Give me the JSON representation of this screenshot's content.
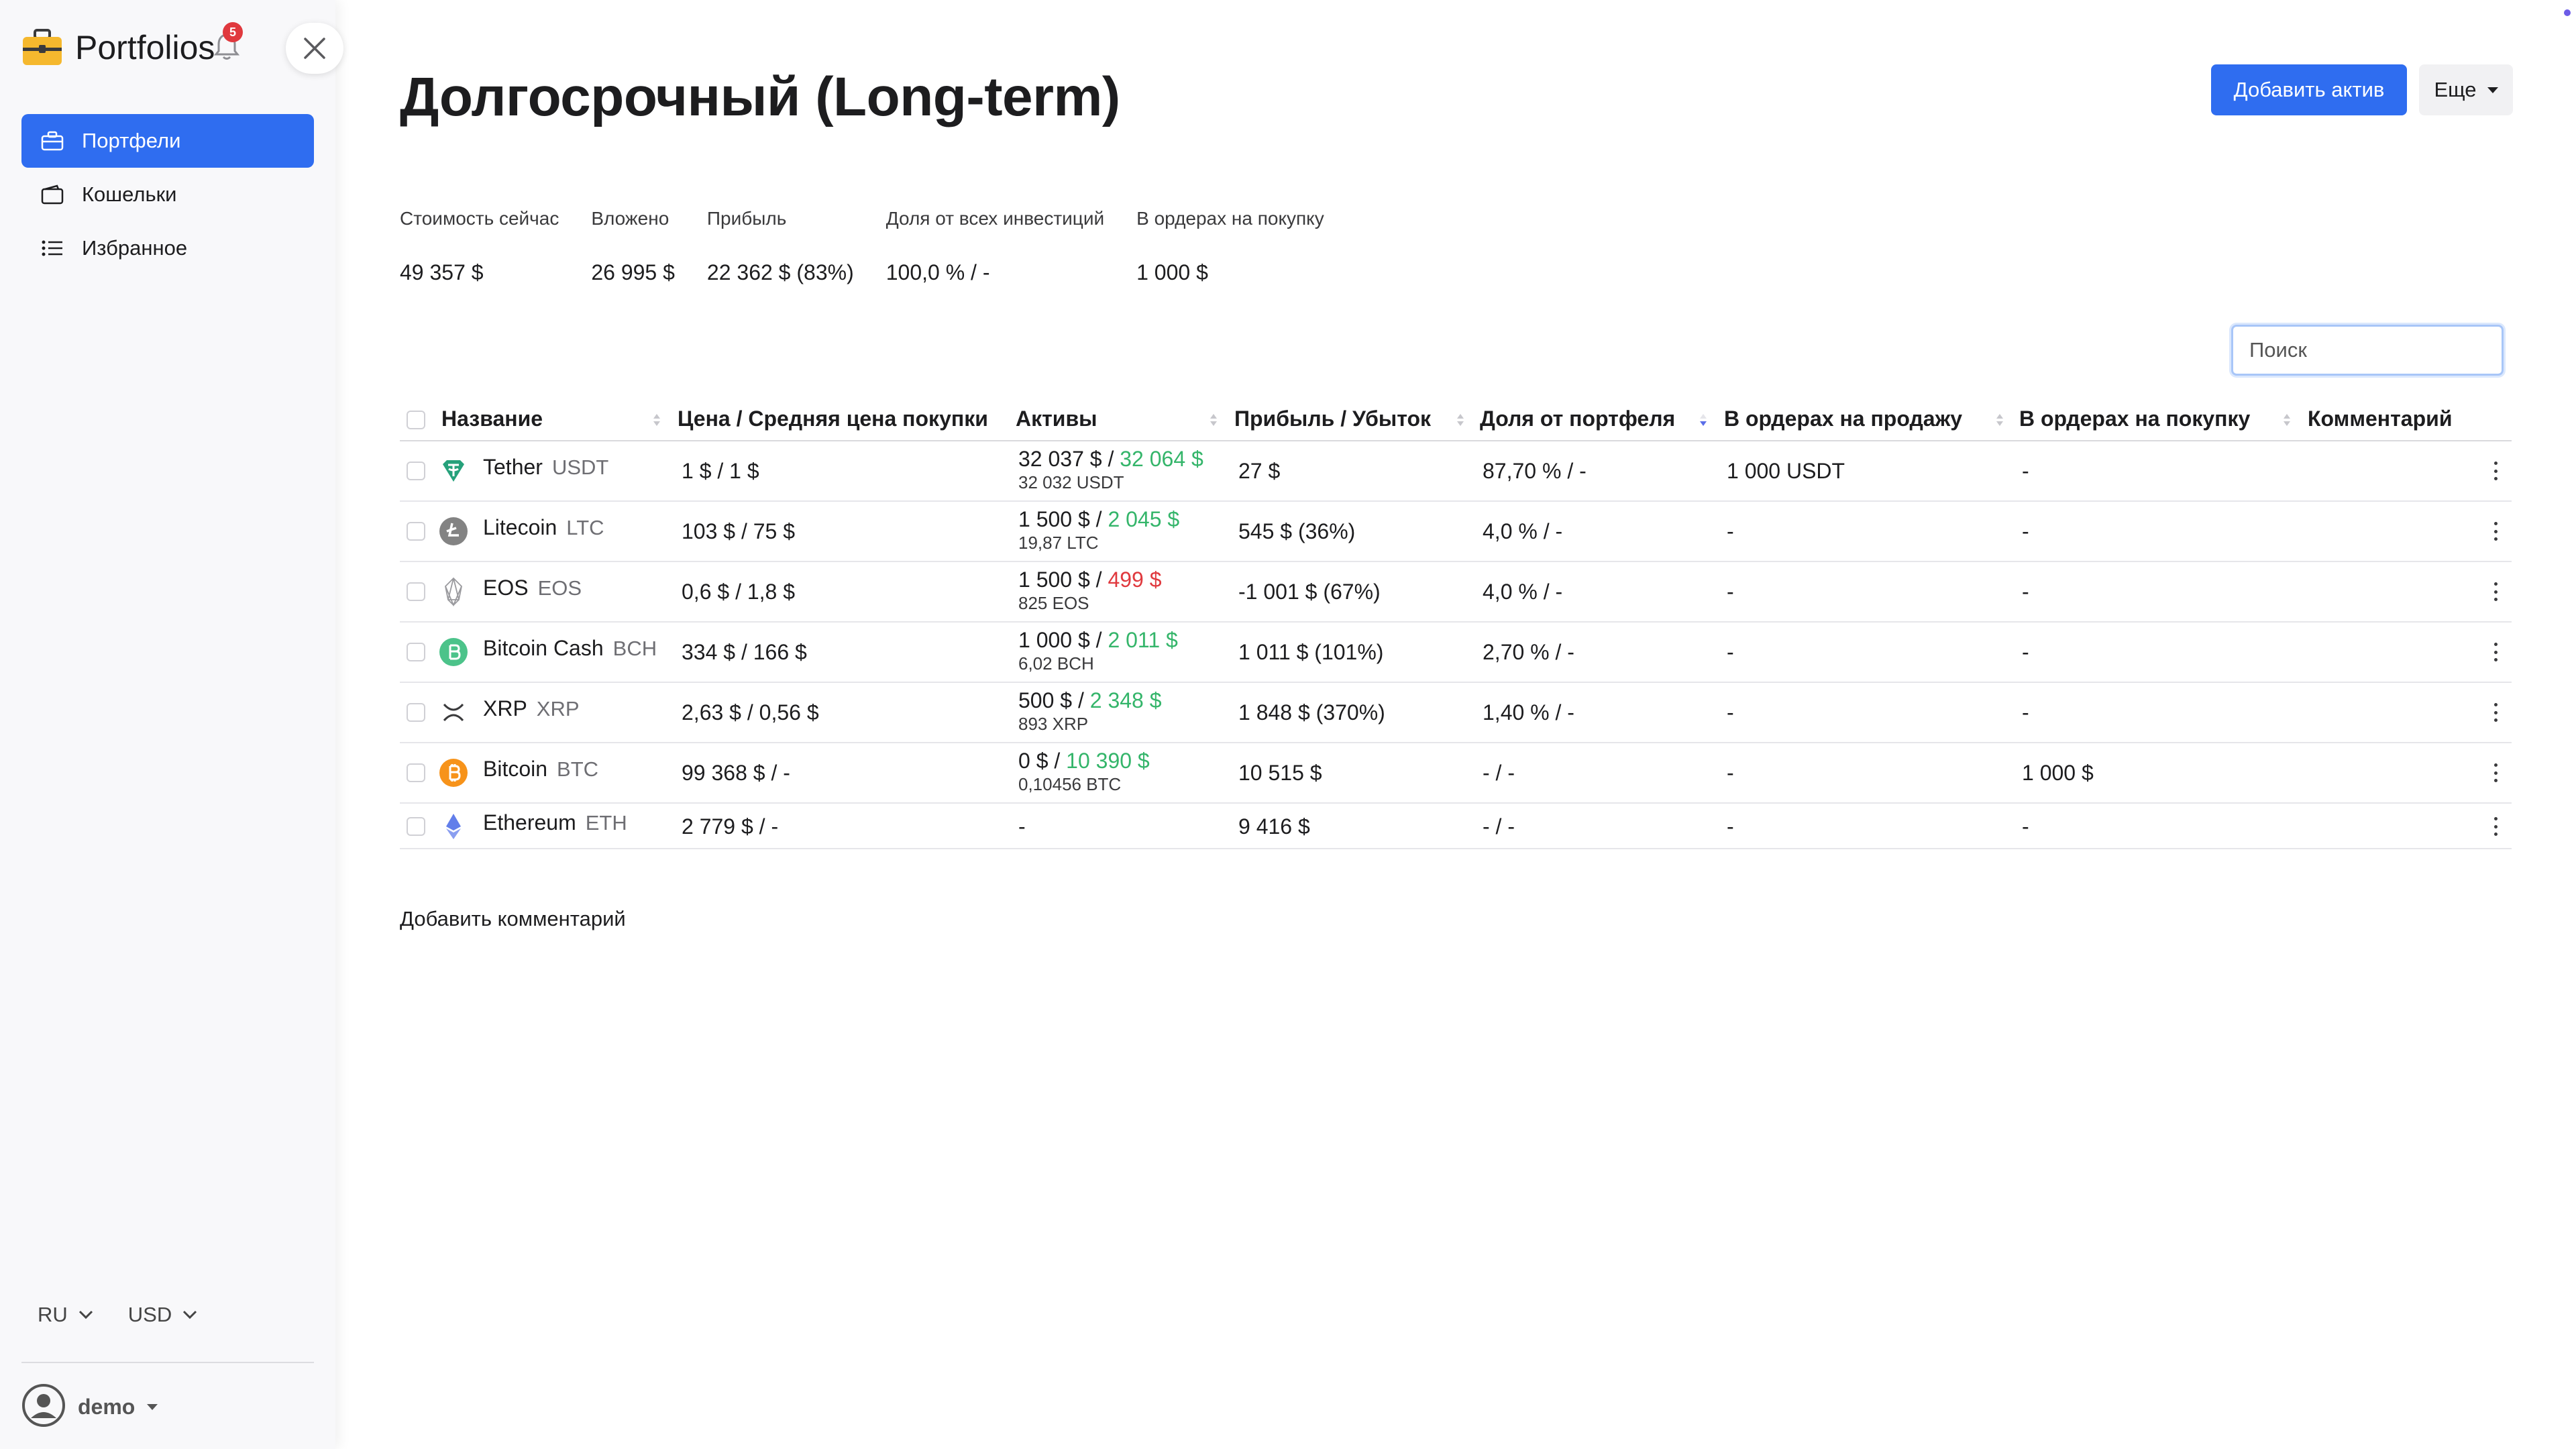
{
  "app": {
    "name": "Portfolios",
    "notifications": "5"
  },
  "sidebar": {
    "items": [
      {
        "label": "Портфели",
        "icon": "briefcase-icon",
        "active": true
      },
      {
        "label": "Кошельки",
        "icon": "wallet-icon",
        "active": false
      },
      {
        "label": "Избранное",
        "icon": "list-icon",
        "active": false
      }
    ],
    "language": "RU",
    "currency": "USD",
    "user": "demo"
  },
  "header": {
    "title": "Долгосрочный (Long-term)",
    "add_button": "Добавить актив",
    "more_button": "Еще"
  },
  "stats": [
    {
      "label": "Стоимость сейчас",
      "value": "49 357 $"
    },
    {
      "label": "Вложено",
      "value": "26 995 $"
    },
    {
      "label": "Прибыль",
      "value": "22 362 $ (83%)"
    },
    {
      "label": "Доля от всех инвестиций",
      "value": "100,0 % / -"
    },
    {
      "label": "В ордерах на покупку",
      "value": "1 000 $"
    }
  ],
  "search": {
    "placeholder": "Поиск"
  },
  "table": {
    "columns": [
      "Название",
      "Цена / Средняя цена покупки",
      "Активы",
      "Прибыль / Убыток",
      "Доля от портфеля",
      "В ордерах на продажу",
      "В ордерах на покупку",
      "Комментарий"
    ],
    "rows": [
      {
        "name": "Tether",
        "ticker": "USDT",
        "icon": "tether-icon",
        "price": "1 $ / 1 $",
        "assets_value": "32 037 $ / ",
        "assets_invested": "32 064 $",
        "assets_invested_tone": "green",
        "assets_amount": "32 032 USDT",
        "profit": "27 $",
        "profit_tone": "green",
        "share": "87,70 % / -",
        "sell_orders": "1 000 USDT",
        "buy_orders": "-",
        "comment": ""
      },
      {
        "name": "Litecoin",
        "ticker": "LTC",
        "icon": "litecoin-icon",
        "price": "103 $ / 75 $",
        "assets_value": "1 500 $ / ",
        "assets_invested": "2 045 $",
        "assets_invested_tone": "green",
        "assets_amount": "19,87 LTC",
        "profit": "545 $ (36%)",
        "profit_tone": "green",
        "share": "4,0 % / -",
        "sell_orders": "-",
        "buy_orders": "-",
        "comment": ""
      },
      {
        "name": "EOS",
        "ticker": "EOS",
        "icon": "eos-icon",
        "price": "0,6 $ / 1,8 $",
        "assets_value": "1 500 $ / ",
        "assets_invested": "499 $",
        "assets_invested_tone": "red",
        "assets_amount": "825 EOS",
        "profit": "-1 001 $ (67%)",
        "profit_tone": "red",
        "share": "4,0 % / -",
        "sell_orders": "-",
        "buy_orders": "-",
        "comment": ""
      },
      {
        "name": "Bitcoin Cash",
        "ticker": "BCH",
        "icon": "bitcoin-cash-icon",
        "price": "334 $ / 166 $",
        "assets_value": "1 000 $ / ",
        "assets_invested": "2 011 $",
        "assets_invested_tone": "green",
        "assets_amount": "6,02 BCH",
        "profit": "1 011 $ (101%)",
        "profit_tone": "green",
        "share": "2,70 % / -",
        "sell_orders": "-",
        "buy_orders": "-",
        "comment": ""
      },
      {
        "name": "XRP",
        "ticker": "XRP",
        "icon": "xrp-icon",
        "price": "2,63 $ / 0,56 $",
        "assets_value": "500 $ / ",
        "assets_invested": "2 348 $",
        "assets_invested_tone": "green",
        "assets_amount": "893 XRP",
        "profit": "1 848 $ (370%)",
        "profit_tone": "green",
        "share": "1,40 % / -",
        "sell_orders": "-",
        "buy_orders": "-",
        "comment": ""
      },
      {
        "name": "Bitcoin",
        "ticker": "BTC",
        "icon": "bitcoin-icon",
        "price": "99 368 $ / -",
        "assets_value": "0 $ / ",
        "assets_invested": "10 390 $",
        "assets_invested_tone": "green",
        "assets_amount": "0,10456 BTC",
        "profit": "10 515 $",
        "profit_tone": "green",
        "share": "- / -",
        "sell_orders": "-",
        "buy_orders": "1 000 $",
        "comment": ""
      },
      {
        "name": "Ethereum",
        "ticker": "ETH",
        "icon": "ethereum-icon",
        "price": "2 779 $ / -",
        "assets_value": "-",
        "assets_invested": "",
        "assets_invested_tone": "green",
        "assets_amount": "",
        "profit": "9 416 $",
        "profit_tone": "green",
        "share": "- / -",
        "sell_orders": "-",
        "buy_orders": "-",
        "comment": ""
      }
    ]
  },
  "footer": {
    "add_comment": "Добавить комментарий"
  },
  "colors": {
    "accent": "#2f6df0",
    "positive": "#34b56a",
    "negative": "#e0393e",
    "badge": "#e0393e"
  }
}
